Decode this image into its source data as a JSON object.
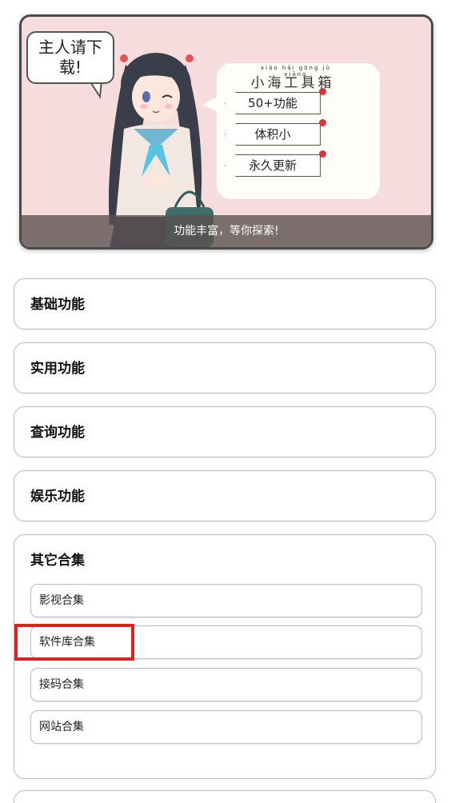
{
  "banner": {
    "speech_left": "主人请下\n载!",
    "pinyin": "xiǎo hǎi gōng jù xiāng",
    "toolbox_title": "小海工具箱",
    "tags": [
      "50+功能",
      "体积小",
      "永久更新"
    ],
    "caption": "功能丰富，等你探索!",
    "colors": {
      "background": "#f6dcdc",
      "heart": "#e0303c"
    }
  },
  "categories": [
    {
      "label": "基础功能"
    },
    {
      "label": "实用功能"
    },
    {
      "label": "查询功能"
    },
    {
      "label": "娱乐功能"
    },
    {
      "label": "其它合集",
      "expanded": true
    }
  ],
  "other_collections": {
    "items": [
      "影视合集",
      "软件库合集",
      "接码合集",
      "网站合集"
    ],
    "highlighted": "软件库合集"
  },
  "colors": {
    "highlight": "#e0201e",
    "card_border": "#bdbdbd"
  }
}
